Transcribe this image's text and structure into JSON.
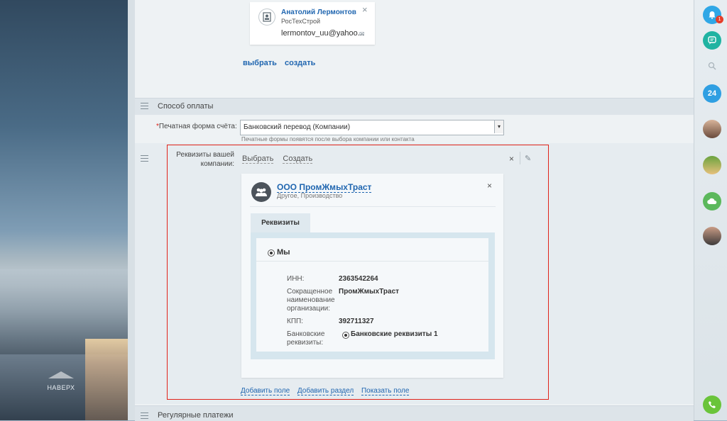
{
  "contact": {
    "name": "Анатолий Лермонтов",
    "company": "РосТехСтрой",
    "email": "lermontov_uu@yahoo..."
  },
  "contact_links": {
    "choose": "выбрать",
    "create": "создать"
  },
  "section_payment": {
    "title": "Способ оплаты"
  },
  "print_form": {
    "label": "Печатная форма счёта:",
    "value": "Банковский перевод (Компании)",
    "hint": "Печатные формы появятся после выбора компании или контакта"
  },
  "requisites": {
    "label": "Реквизиты вашей компании:",
    "action_choose": "Выбрать",
    "action_create": "Создать",
    "company_name": "ООО ПромЖмыхТраст",
    "company_type": "Другое, Производство",
    "tab": "Реквизиты",
    "preset": "Мы",
    "fields": [
      {
        "label": "ИНН:",
        "value": "2363542264"
      },
      {
        "label": "Сокращенное наименование организации:",
        "value": "ПромЖмыхТраст"
      },
      {
        "label": "КПП:",
        "value": "392711327"
      },
      {
        "label": "Банковские реквизиты:",
        "value": "Банковские реквизиты 1"
      }
    ]
  },
  "bottom_links": {
    "add_field": "Добавить поле",
    "add_section": "Добавить раздел",
    "show_field": "Показать поле"
  },
  "section_regular": {
    "title": "Регулярные платежи"
  },
  "to_top": "НАВЕРХ",
  "right_bar": {
    "notif_count": "1",
    "calendar": "24"
  },
  "colors": {
    "accent": "#2066b0",
    "highlight": "#e0231a",
    "phone": "#6ac43a",
    "chat": "#20b3a2"
  }
}
